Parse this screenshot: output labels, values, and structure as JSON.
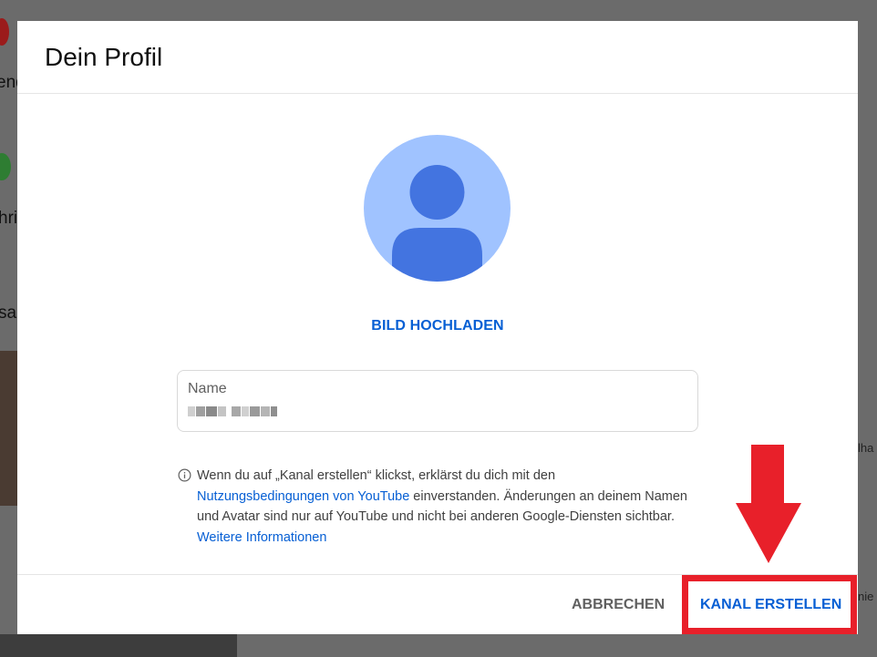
{
  "background": {
    "fragments": [
      "end",
      "hri",
      "sa",
      "lha",
      "nie"
    ]
  },
  "dialog": {
    "title": "Dein Profil",
    "upload_label": "BILD HOCHLADEN",
    "name_field": {
      "label": "Name",
      "value_redacted": true
    },
    "info": {
      "icon": "info-icon",
      "text_1": "Wenn du auf „Kanal erstellen“ klickst, erklärst du dich mit den ",
      "link_terms": "Nutzungsbedingungen von YouTube",
      "text_2": " einverstanden. Änderungen an deinem Namen und Avatar sind nur auf YouTube und nicht bei anderen Google-Diensten sichtbar. ",
      "link_more": "Weitere Informationen"
    },
    "footer": {
      "cancel_label": "ABBRECHEN",
      "create_label": "KANAL ERSTELLEN"
    }
  },
  "annotation": {
    "color": "#e8202a",
    "arrow_icon": "down-arrow-icon"
  },
  "colors": {
    "accent": "#065fd4",
    "avatar_bg": "#a0c3ff",
    "avatar_fg": "#4374e0"
  }
}
